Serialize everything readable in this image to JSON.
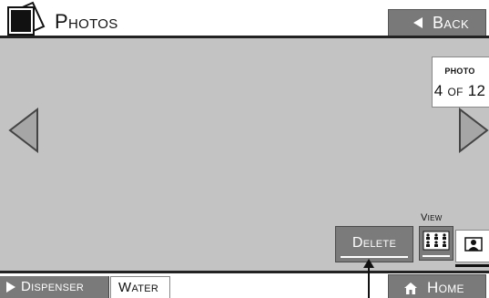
{
  "header": {
    "title": "Photos",
    "back_label": "Back"
  },
  "counter": {
    "label": "photo",
    "value": "4 of 12"
  },
  "actions": {
    "delete_label": "Delete"
  },
  "view": {
    "label": "View",
    "options": [
      "grid-view-icon",
      "single-view-icon"
    ],
    "selected": "single-view-icon"
  },
  "footer": {
    "tabs": [
      {
        "label": "Dispenser",
        "selected": false
      },
      {
        "label": "Water",
        "selected": true
      }
    ],
    "home_label": "Home"
  },
  "colors": {
    "button_gray": "#7b7b7b",
    "screen_gray": "#c3c3c3",
    "text_dark": "#111111"
  }
}
